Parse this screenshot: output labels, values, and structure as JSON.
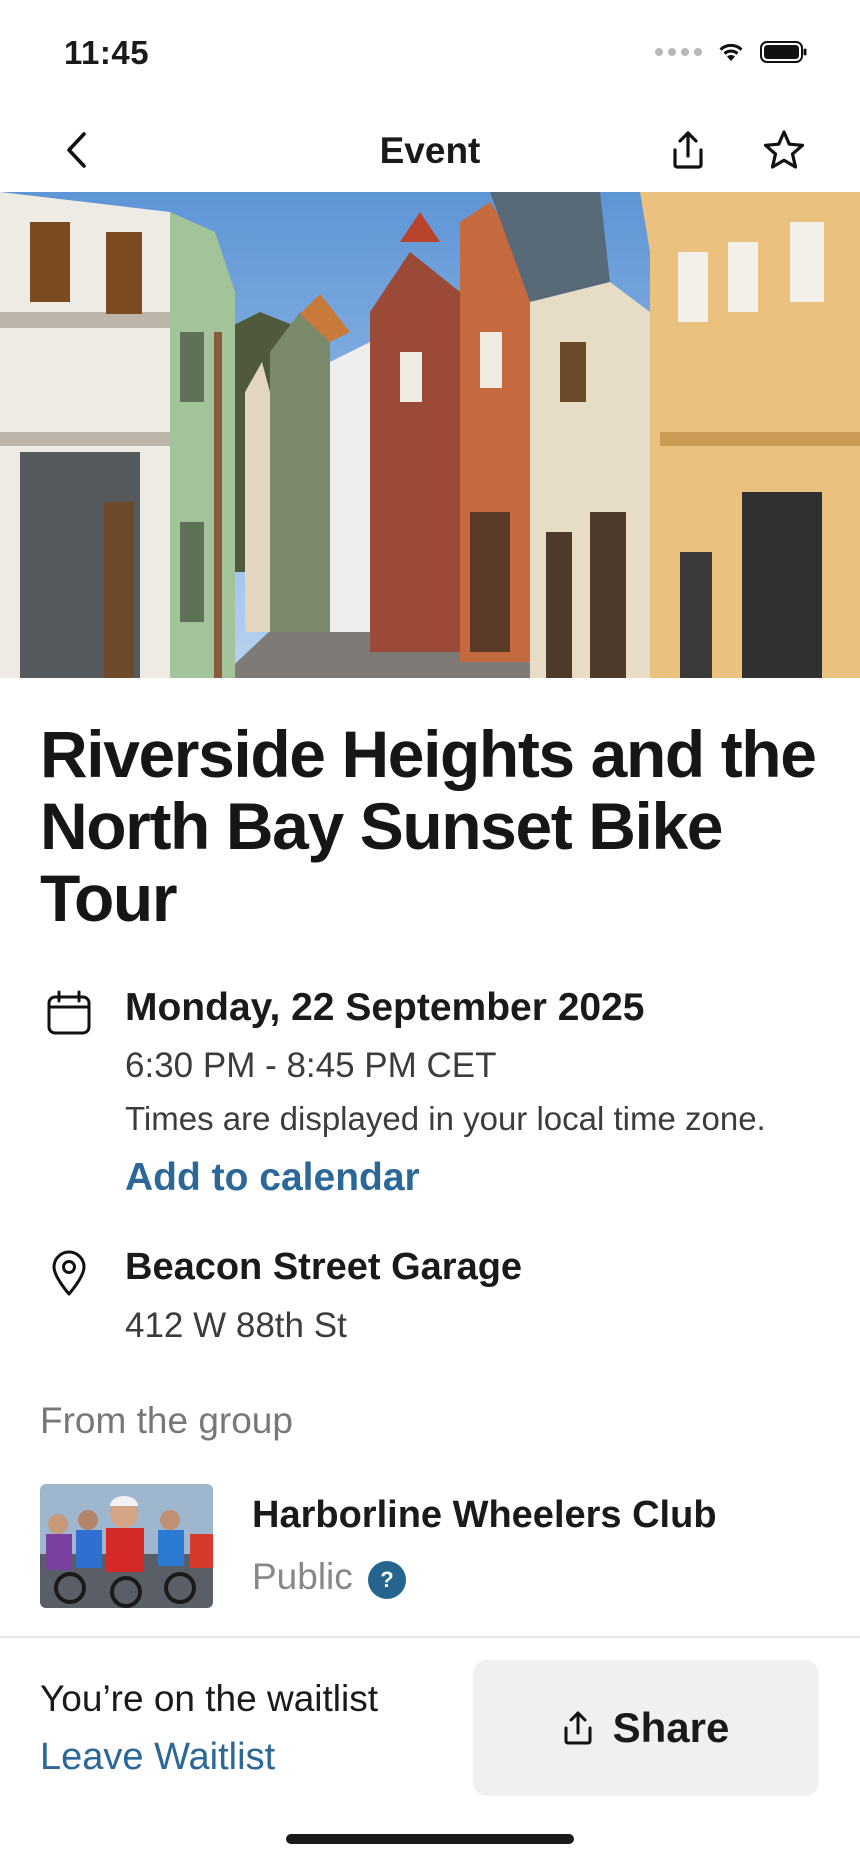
{
  "status_bar": {
    "time": "11:45",
    "icons": [
      "signal-dots-icon",
      "wifi-icon",
      "battery-icon"
    ]
  },
  "nav": {
    "title": "Event",
    "icons": [
      "back-chevron-icon",
      "share-icon",
      "star-icon"
    ]
  },
  "hero": {
    "description_icon": "street-photo-image"
  },
  "event": {
    "title": "Riverside Heights and the North Bay Sunset Bike Tour",
    "date": "Monday, 22 September 2025",
    "time_range": "6:30 PM - 8:45 PM CET",
    "timezone_note": "Times are displayed in your local time zone.",
    "add_to_calendar": "Add to calendar",
    "location_name": "Beacon Street Garage",
    "location_address": "412 W 88th St"
  },
  "group": {
    "heading": "From the group",
    "name": "Harborline Wheelers Club",
    "privacy": "Public",
    "help": "?"
  },
  "bottom": {
    "status": "You’re on the waitlist",
    "leave": "Leave Waitlist",
    "share": "Share"
  },
  "colors": {
    "link": "#2b6898",
    "badge": "#24648f",
    "share_bg": "#f0f0f1",
    "muted_text": "#777777"
  }
}
